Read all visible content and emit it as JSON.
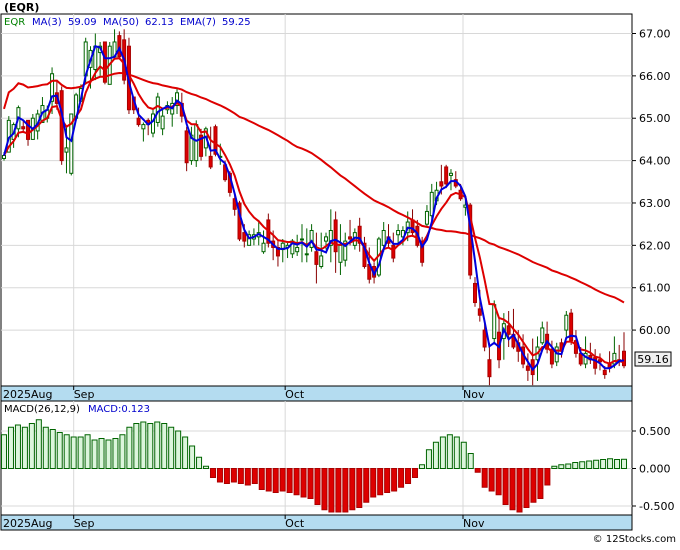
{
  "title": "(EQR)",
  "footer": "© 12Stocks.com",
  "chart_data": [
    {
      "type": "candlestick",
      "symbol": "EQR",
      "legend": [
        {
          "text": "EQR",
          "color": "#008000"
        },
        {
          "text": "MA(3)",
          "color": "#0000cc"
        },
        {
          "text": "59.09",
          "color": "#0000cc"
        },
        {
          "text": "MA(50)",
          "color": "#0000cc"
        },
        {
          "text": "62.13",
          "color": "#0000cc"
        },
        {
          "text": "EMA(7)",
          "color": "#0000cc"
        },
        {
          "text": "59.25",
          "color": "#0000cc"
        }
      ],
      "last_price": "59.16",
      "yticks": [
        "67.00",
        "66.00",
        "65.00",
        "64.00",
        "63.00",
        "62.00",
        "61.00",
        "60.00"
      ],
      "ytick_values": [
        67,
        66,
        65,
        64,
        63,
        62,
        61,
        60
      ],
      "ylim": [
        58.68,
        67.46
      ],
      "xticks": [
        "2025Aug",
        "Sep",
        "Oct",
        "Nov"
      ],
      "xtick_index": [
        0,
        15,
        59,
        96
      ],
      "grid": true,
      "colors": {
        "up_fill": "#ffffff",
        "up_border": "#006400",
        "down_fill": "#dd0000",
        "ma3": "#0000dd",
        "ma50": "#dd0000",
        "ema7": "#dd0000"
      },
      "candles": [
        [
          64.05,
          64.2,
          64.0,
          64.12
        ],
        [
          64.2,
          65.05,
          64.2,
          64.95
        ],
        [
          64.5,
          64.9,
          64.3,
          64.85
        ],
        [
          64.75,
          65.3,
          64.55,
          65.25
        ],
        [
          64.8,
          64.95,
          64.65,
          64.75
        ],
        [
          64.95,
          64.95,
          64.35,
          64.5
        ],
        [
          64.5,
          65.1,
          64.5,
          65.0
        ],
        [
          64.7,
          65.2,
          64.5,
          65.1
        ],
        [
          64.9,
          65.5,
          64.9,
          65.3
        ],
        [
          65.0,
          65.3,
          64.9,
          65.2
        ],
        [
          65.4,
          66.2,
          65.1,
          66.05
        ],
        [
          65.6,
          65.9,
          65.2,
          65.35
        ],
        [
          65.65,
          65.75,
          63.9,
          64.0
        ],
        [
          64.2,
          64.8,
          63.7,
          64.3
        ],
        [
          63.7,
          65.1,
          63.65,
          65.1
        ],
        [
          65.0,
          65.6,
          65.0,
          65.55
        ],
        [
          65.4,
          65.8,
          65.4,
          65.7
        ],
        [
          66.0,
          66.9,
          65.8,
          66.8
        ],
        [
          66.2,
          66.7,
          65.7,
          66.6
        ],
        [
          66.15,
          67.0,
          65.9,
          66.7
        ],
        [
          66.55,
          66.8,
          66.0,
          66.7
        ],
        [
          66.8,
          66.8,
          65.8,
          65.85
        ],
        [
          65.8,
          66.8,
          65.8,
          66.7
        ],
        [
          66.45,
          67.1,
          66.4,
          66.8
        ],
        [
          66.95,
          67.05,
          66.4,
          66.45
        ],
        [
          66.85,
          67.1,
          65.8,
          65.9
        ],
        [
          66.7,
          66.9,
          65.1,
          65.2
        ],
        [
          65.5,
          65.5,
          65.1,
          65.2
        ],
        [
          65.0,
          65.25,
          64.8,
          64.85
        ],
        [
          64.75,
          64.9,
          64.45,
          64.85
        ],
        [
          64.95,
          65.0,
          64.6,
          64.85
        ],
        [
          64.65,
          65.2,
          64.55,
          65.1
        ],
        [
          64.9,
          65.6,
          64.8,
          65.5
        ],
        [
          64.75,
          65.2,
          64.6,
          65.05
        ],
        [
          65.2,
          65.4,
          65.1,
          65.3
        ],
        [
          65.1,
          65.5,
          64.8,
          65.35
        ],
        [
          65.3,
          65.7,
          65.1,
          65.6
        ],
        [
          65.35,
          65.6,
          64.9,
          65.05
        ],
        [
          64.7,
          64.8,
          63.75,
          63.95
        ],
        [
          64.0,
          64.8,
          63.9,
          64.6
        ],
        [
          64.0,
          64.95,
          63.85,
          64.85
        ],
        [
          64.6,
          64.75,
          64.0,
          64.1
        ],
        [
          64.3,
          64.8,
          64.1,
          64.75
        ],
        [
          64.1,
          64.8,
          63.8,
          63.85
        ],
        [
          64.8,
          64.85,
          64.1,
          64.15
        ],
        [
          64.1,
          64.4,
          63.9,
          64.1
        ],
        [
          63.9,
          64.0,
          63.5,
          63.55
        ],
        [
          63.7,
          63.75,
          63.15,
          63.25
        ],
        [
          63.1,
          63.2,
          62.7,
          62.85
        ],
        [
          63.0,
          63.05,
          62.1,
          62.15
        ],
        [
          62.3,
          62.5,
          61.95,
          62.1
        ],
        [
          62.0,
          62.35,
          62.0,
          62.25
        ],
        [
          62.15,
          62.4,
          62.0,
          62.25
        ],
        [
          62.2,
          62.6,
          62.0,
          62.3
        ],
        [
          61.85,
          62.35,
          61.8,
          62.05
        ],
        [
          62.6,
          62.75,
          61.95,
          62.05
        ],
        [
          62.1,
          62.35,
          61.65,
          61.95
        ],
        [
          61.95,
          62.1,
          61.5,
          61.75
        ],
        [
          61.9,
          62.15,
          61.6,
          62.05
        ],
        [
          61.95,
          62.1,
          61.7,
          62.0
        ],
        [
          61.8,
          62.15,
          61.7,
          62.1
        ],
        [
          61.85,
          62.25,
          61.75,
          61.95
        ],
        [
          62.15,
          62.5,
          61.6,
          62.15
        ],
        [
          61.8,
          62.4,
          61.6,
          61.8
        ],
        [
          61.95,
          62.5,
          61.85,
          62.35
        ],
        [
          61.85,
          62.3,
          61.1,
          61.55
        ],
        [
          61.5,
          62.3,
          61.45,
          61.75
        ],
        [
          62.1,
          62.3,
          61.9,
          62.2
        ],
        [
          62.0,
          62.85,
          61.6,
          62.35
        ],
        [
          62.6,
          62.8,
          61.35,
          61.85
        ],
        [
          61.6,
          62.5,
          61.3,
          62.0
        ],
        [
          61.65,
          62.3,
          61.5,
          62.1
        ],
        [
          62.2,
          62.6,
          62.0,
          62.15
        ],
        [
          62.0,
          62.4,
          61.9,
          62.3
        ],
        [
          62.45,
          62.65,
          61.85,
          62.05
        ],
        [
          62.05,
          62.2,
          61.45,
          61.5
        ],
        [
          61.55,
          61.95,
          61.1,
          61.2
        ],
        [
          61.5,
          61.6,
          61.1,
          61.25
        ],
        [
          61.3,
          62.2,
          61.25,
          62.15
        ],
        [
          62.0,
          62.55,
          61.85,
          62.35
        ],
        [
          62.2,
          62.5,
          61.95,
          62.05
        ],
        [
          62.0,
          62.3,
          61.6,
          61.7
        ],
        [
          62.25,
          62.5,
          62.05,
          62.35
        ],
        [
          62.2,
          62.45,
          62.0,
          62.35
        ],
        [
          62.3,
          62.8,
          62.1,
          62.55
        ],
        [
          62.6,
          62.85,
          62.2,
          62.3
        ],
        [
          62.45,
          62.6,
          61.95,
          62.0
        ],
        [
          62.1,
          62.2,
          61.5,
          61.6
        ],
        [
          62.5,
          62.95,
          62.45,
          62.8
        ],
        [
          62.7,
          63.45,
          62.6,
          63.25
        ],
        [
          63.05,
          63.5,
          62.95,
          63.3
        ],
        [
          63.5,
          63.9,
          63.2,
          63.4
        ],
        [
          63.85,
          63.9,
          63.35,
          63.45
        ],
        [
          63.65,
          63.8,
          63.3,
          63.7
        ],
        [
          63.55,
          63.75,
          63.35,
          63.4
        ],
        [
          63.3,
          63.45,
          63.05,
          63.1
        ],
        [
          62.9,
          63.1,
          62.7,
          62.95
        ],
        [
          62.95,
          63.0,
          61.2,
          61.3
        ],
        [
          61.1,
          61.25,
          60.55,
          60.65
        ],
        [
          60.5,
          60.95,
          60.2,
          60.35
        ],
        [
          60.0,
          60.2,
          59.5,
          59.6
        ],
        [
          59.3,
          59.7,
          58.7,
          58.9
        ],
        [
          59.8,
          60.7,
          59.7,
          60.6
        ],
        [
          59.95,
          60.3,
          59.1,
          59.3
        ],
        [
          59.8,
          60.4,
          59.3,
          60.15
        ],
        [
          60.1,
          60.45,
          59.6,
          59.9
        ],
        [
          59.9,
          60.5,
          59.55,
          59.6
        ],
        [
          59.7,
          60.0,
          59.25,
          59.5
        ],
        [
          59.6,
          59.9,
          59.1,
          59.2
        ],
        [
          59.15,
          59.45,
          58.8,
          59.05
        ],
        [
          59.3,
          59.8,
          58.7,
          58.95
        ],
        [
          59.3,
          59.85,
          58.8,
          59.6
        ],
        [
          59.7,
          60.2,
          59.65,
          60.05
        ],
        [
          59.9,
          60.2,
          59.45,
          59.55
        ],
        [
          59.55,
          59.75,
          59.1,
          59.2
        ],
        [
          59.25,
          59.7,
          59.15,
          59.6
        ],
        [
          59.7,
          59.8,
          59.35,
          59.5
        ],
        [
          60.0,
          60.45,
          59.8,
          60.35
        ],
        [
          60.4,
          60.5,
          59.65,
          59.75
        ],
        [
          59.75,
          60.0,
          59.35,
          59.45
        ],
        [
          59.45,
          59.6,
          59.15,
          59.2
        ],
        [
          59.2,
          59.85,
          59.1,
          59.45
        ],
        [
          59.4,
          59.7,
          59.2,
          59.3
        ],
        [
          59.35,
          59.55,
          58.95,
          59.1
        ],
        [
          59.3,
          59.45,
          59.05,
          59.25
        ],
        [
          59.05,
          59.15,
          58.85,
          58.95
        ],
        [
          59.2,
          59.5,
          59.0,
          59.1
        ],
        [
          59.2,
          59.85,
          59.1,
          59.45
        ],
        [
          59.3,
          59.65,
          59.15,
          59.25
        ],
        [
          59.5,
          59.95,
          59.1,
          59.16
        ]
      ]
    },
    {
      "type": "bar",
      "title": "MACD(26,12,9)",
      "value_label": "MACD:0.123",
      "value_label_color": "#0000cc",
      "yticks": [
        "0.500",
        "0.000",
        "-0.500"
      ],
      "ytick_values": [
        0.5,
        0.0,
        -0.5
      ],
      "ylim": [
        -0.62,
        0.9
      ],
      "xticks": [
        "2025Aug",
        "Sep",
        "Oct",
        "Nov"
      ],
      "colors": {
        "positive": "#dcf5dc",
        "positive_border": "#006400",
        "negative": "#dd0000"
      },
      "values": [
        0.45,
        0.55,
        0.58,
        0.55,
        0.6,
        0.65,
        0.55,
        0.52,
        0.48,
        0.45,
        0.42,
        0.42,
        0.45,
        0.38,
        0.4,
        0.38,
        0.4,
        0.45,
        0.55,
        0.6,
        0.62,
        0.6,
        0.62,
        0.6,
        0.55,
        0.5,
        0.42,
        0.3,
        0.15,
        0.03,
        -0.12,
        -0.18,
        -0.2,
        -0.18,
        -0.2,
        -0.22,
        -0.2,
        -0.28,
        -0.3,
        -0.32,
        -0.3,
        -0.32,
        -0.35,
        -0.38,
        -0.4,
        -0.48,
        -0.55,
        -0.58,
        -0.58,
        -0.58,
        -0.55,
        -0.52,
        -0.45,
        -0.38,
        -0.35,
        -0.32,
        -0.3,
        -0.25,
        -0.2,
        -0.12,
        0.05,
        0.25,
        0.35,
        0.42,
        0.45,
        0.42,
        0.35,
        0.2,
        -0.05,
        -0.25,
        -0.3,
        -0.35,
        -0.48,
        -0.55,
        -0.58,
        -0.52,
        -0.45,
        -0.4,
        -0.22,
        0.03,
        0.05,
        0.06,
        0.08,
        0.09,
        0.1,
        0.11,
        0.12,
        0.13,
        0.12,
        0.123
      ]
    }
  ]
}
